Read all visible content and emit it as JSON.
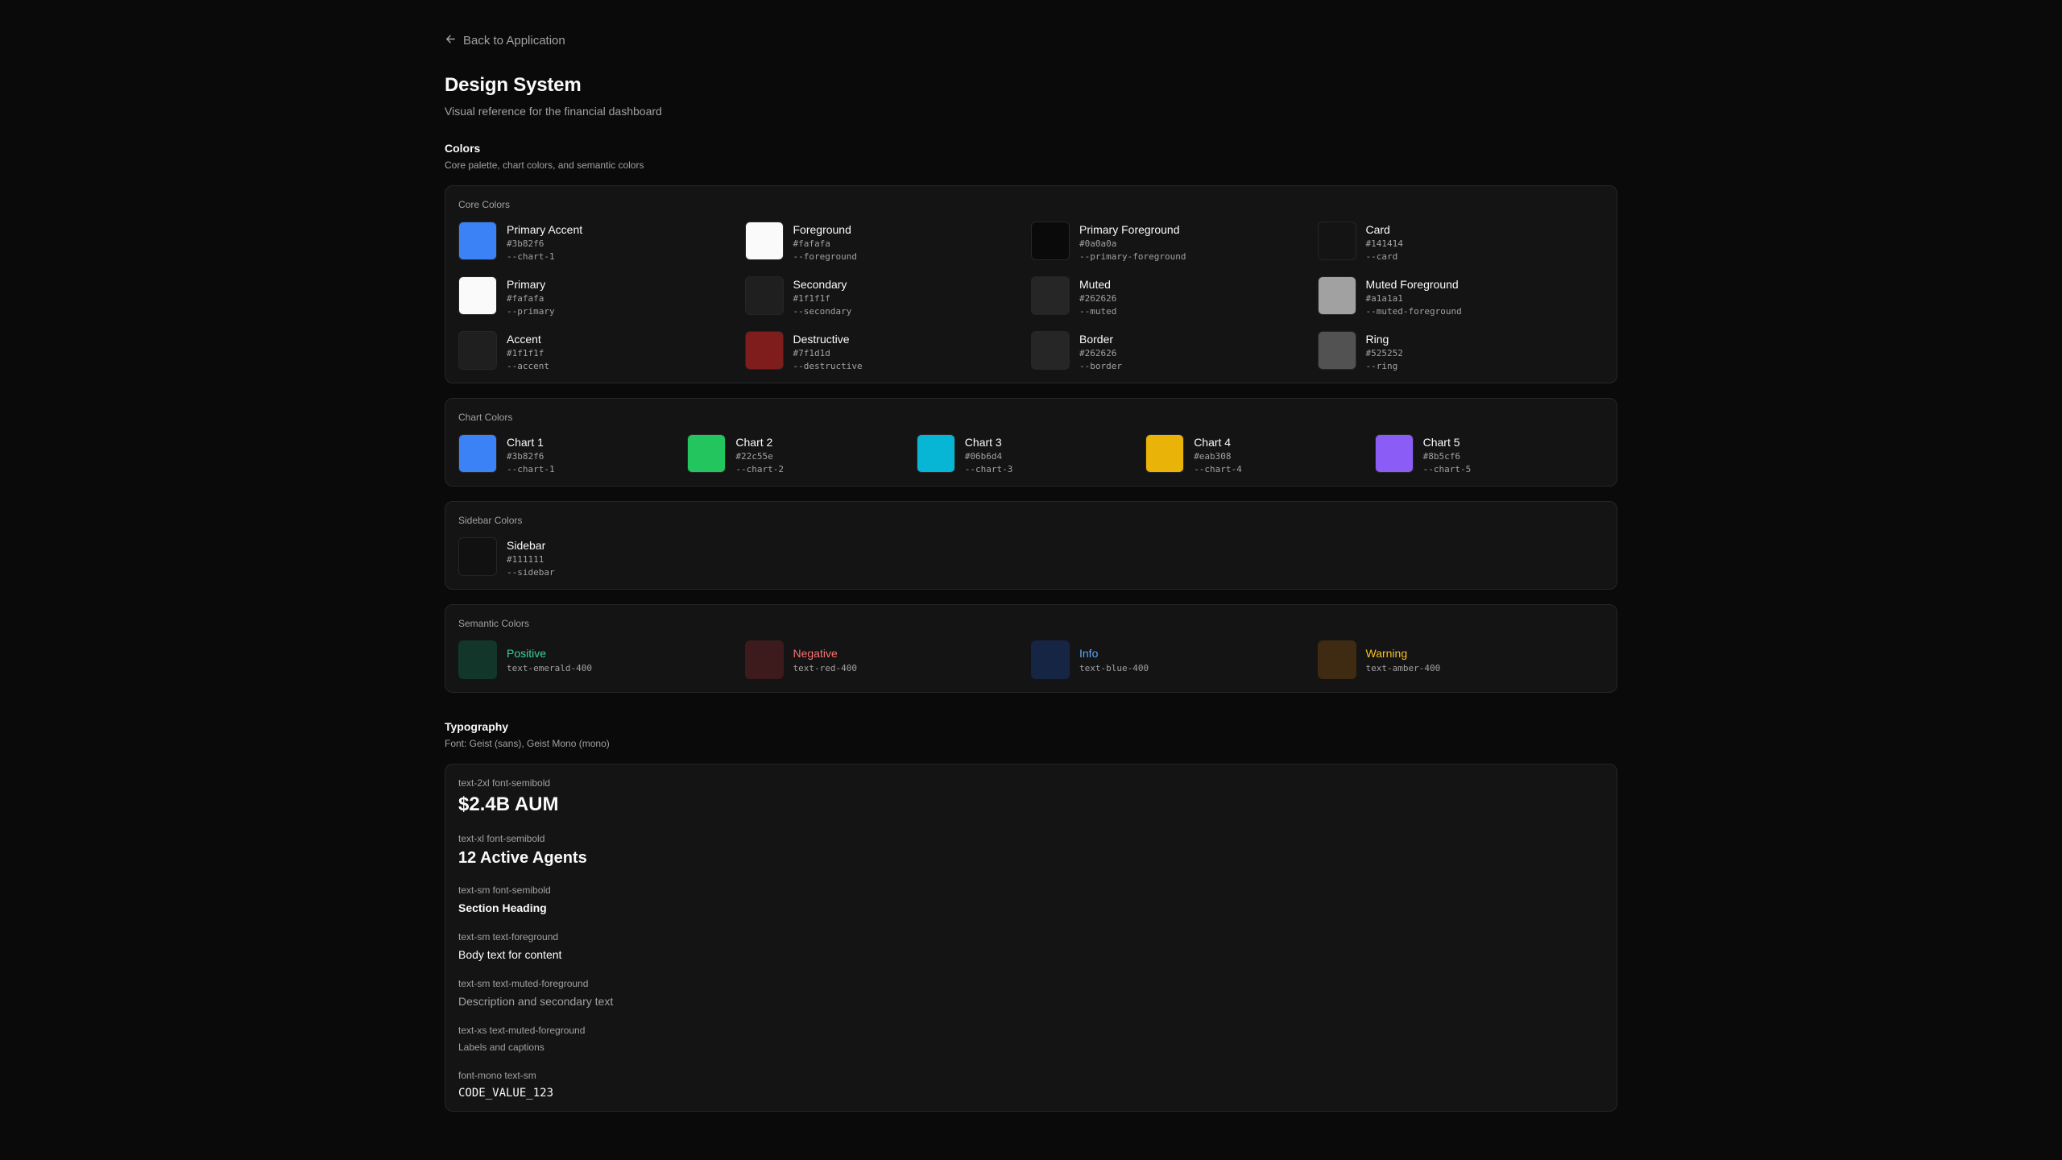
{
  "nav": {
    "back_label": "Back to Application"
  },
  "header": {
    "title": "Design System",
    "subtitle": "Visual reference for the financial dashboard"
  },
  "colors_section": {
    "title": "Colors",
    "description": "Core palette, chart colors, and semantic colors"
  },
  "core_colors": {
    "label": "Core Colors",
    "items": [
      {
        "name": "Primary Accent",
        "hex": "#3b82f6",
        "var": "--chart-1",
        "color": "#3b82f6"
      },
      {
        "name": "Foreground",
        "hex": "#fafafa",
        "var": "--foreground",
        "color": "#fafafa"
      },
      {
        "name": "Primary Foreground",
        "hex": "#0a0a0a",
        "var": "--primary-foreground",
        "color": "#0a0a0a"
      },
      {
        "name": "Card",
        "hex": "#141414",
        "var": "--card",
        "color": "#141414"
      },
      {
        "name": "Primary",
        "hex": "#fafafa",
        "var": "--primary",
        "color": "#fafafa"
      },
      {
        "name": "Secondary",
        "hex": "#1f1f1f",
        "var": "--secondary",
        "color": "#1f1f1f"
      },
      {
        "name": "Muted",
        "hex": "#262626",
        "var": "--muted",
        "color": "#262626"
      },
      {
        "name": "Muted Foreground",
        "hex": "#a1a1a1",
        "var": "--muted-foreground",
        "color": "#a1a1a1"
      },
      {
        "name": "Accent",
        "hex": "#1f1f1f",
        "var": "--accent",
        "color": "#1f1f1f"
      },
      {
        "name": "Destructive",
        "hex": "#7f1d1d",
        "var": "--destructive",
        "color": "#7f1d1d"
      },
      {
        "name": "Border",
        "hex": "#262626",
        "var": "--border",
        "color": "#262626"
      },
      {
        "name": "Ring",
        "hex": "#525252",
        "var": "--ring",
        "color": "#525252"
      }
    ]
  },
  "chart_colors": {
    "label": "Chart Colors",
    "items": [
      {
        "name": "Chart 1",
        "hex": "#3b82f6",
        "var": "--chart-1",
        "color": "#3b82f6"
      },
      {
        "name": "Chart 2",
        "hex": "#22c55e",
        "var": "--chart-2",
        "color": "#22c55e"
      },
      {
        "name": "Chart 3",
        "hex": "#06b6d4",
        "var": "--chart-3",
        "color": "#06b6d4"
      },
      {
        "name": "Chart 4",
        "hex": "#eab308",
        "var": "--chart-4",
        "color": "#eab308"
      },
      {
        "name": "Chart 5",
        "hex": "#8b5cf6",
        "var": "--chart-5",
        "color": "#8b5cf6"
      }
    ]
  },
  "sidebar_colors": {
    "label": "Sidebar Colors",
    "items": [
      {
        "name": "Sidebar",
        "hex": "#111111",
        "var": "--sidebar",
        "color": "#111111"
      }
    ]
  },
  "semantic_colors": {
    "label": "Semantic Colors",
    "items": [
      {
        "name": "Positive",
        "class": "text-emerald-400",
        "text_color": "#34d399",
        "bg_color": "#12372a"
      },
      {
        "name": "Negative",
        "class": "text-red-400",
        "text_color": "#f87171",
        "bg_color": "#3d1a1c"
      },
      {
        "name": "Info",
        "class": "text-blue-400",
        "text_color": "#60a5fa",
        "bg_color": "#172545"
      },
      {
        "name": "Warning",
        "class": "text-amber-400",
        "text_color": "#fbbf24",
        "bg_color": "#3f2a12"
      }
    ]
  },
  "typography_section": {
    "title": "Typography",
    "description": "Font: Geist (sans), Geist Mono (mono)"
  },
  "typography": [
    {
      "label": "text-2xl font-semibold",
      "sample": "$2.4B AUM",
      "style": "t-2xl"
    },
    {
      "label": "text-xl font-semibold",
      "sample": "12 Active Agents",
      "style": "t-xl"
    },
    {
      "label": "text-sm font-semibold",
      "sample": "Section Heading",
      "style": "t-sm-semi"
    },
    {
      "label": "text-sm text-foreground",
      "sample": "Body text for content",
      "style": "t-sm"
    },
    {
      "label": "text-sm text-muted-foreground",
      "sample": "Description and secondary text",
      "style": "t-muted"
    },
    {
      "label": "text-xs text-muted-foreground",
      "sample": "Labels and captions",
      "style": "t-xs-muted"
    },
    {
      "label": "font-mono text-sm",
      "sample": "CODE_VALUE_123",
      "style": "t-mono"
    }
  ]
}
